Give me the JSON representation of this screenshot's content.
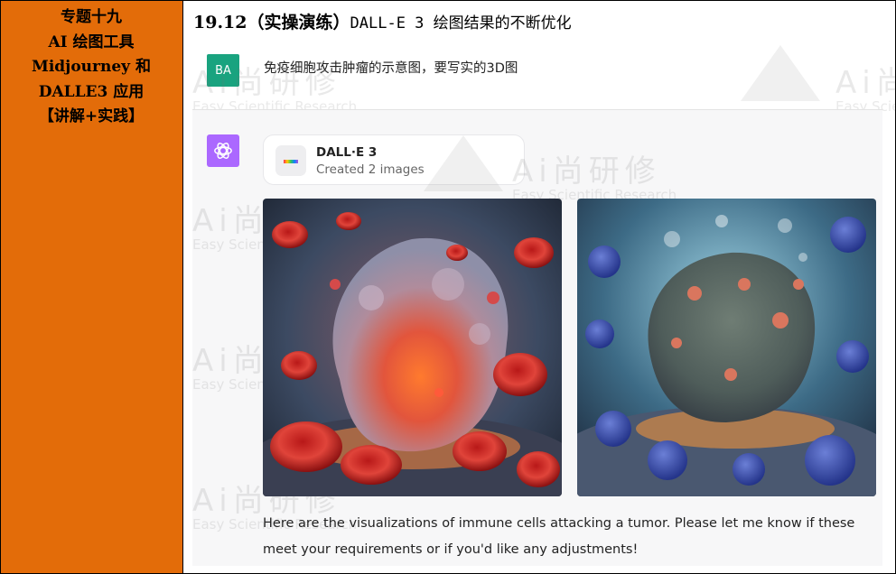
{
  "sidebar": {
    "lines": [
      "专题十九",
      "AI 绘图工具",
      "Midjourney 和",
      "DALLE3 应用",
      "【讲解+实践】"
    ]
  },
  "heading": {
    "number": "19.12",
    "bracket_title": "（实操演练）",
    "title_rest": "DALL-E 3 绘图结果的不断优化"
  },
  "user": {
    "avatar_initials": "BA",
    "message": "免疫细胞攻击肿瘤的示意图，要写实的3D图"
  },
  "assistant": {
    "tool_name": "DALL·E 3",
    "tool_status": "Created 2 images",
    "images": [
      {
        "alt": "Realistic 3D render of a tumor mass surrounded by red blood cells and immune cells"
      },
      {
        "alt": "Realistic 3D render of a tumor mass attacked by blue immune cells"
      }
    ],
    "reply": "Here are the visualizations of immune cells attacking a tumor. Please let me know if these meet your requirements or if you'd like any adjustments!"
  },
  "watermark": {
    "brand": "Ai尚研修",
    "subtitle": "Easy Scientific Research"
  },
  "colors": {
    "sidebar_bg": "#E36C09",
    "user_avatar": "#19A37F",
    "assistant_icon": "#AB68FF",
    "assistant_bg": "#F7F7F8"
  }
}
